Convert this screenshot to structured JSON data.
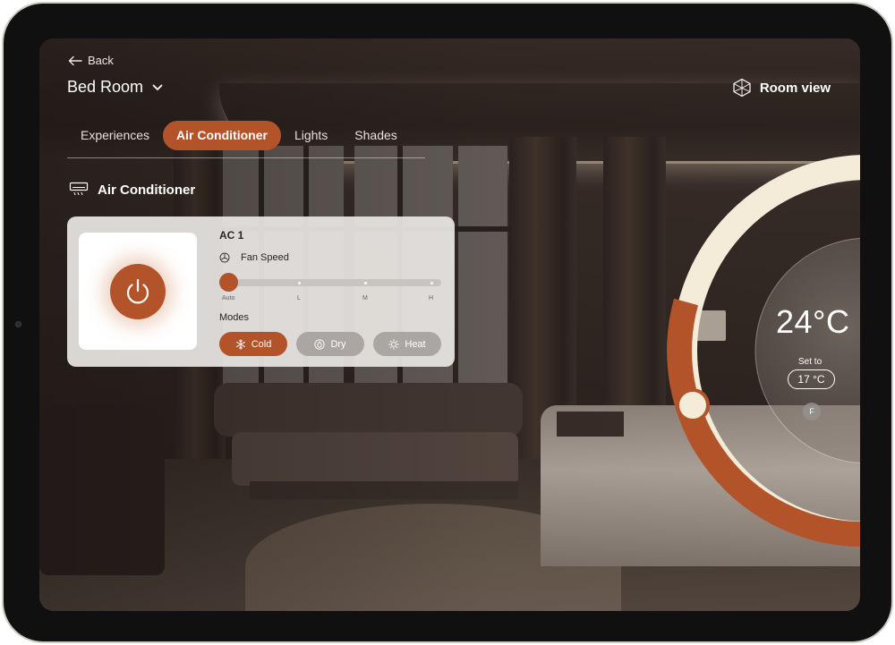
{
  "nav": {
    "back_label": "Back",
    "room_name": "Bed Room",
    "room_view_label": "Room view"
  },
  "tabs": [
    {
      "label": "Experiences",
      "active": false
    },
    {
      "label": "Air Conditioner",
      "active": true
    },
    {
      "label": "Lights",
      "active": false
    },
    {
      "label": "Shades",
      "active": false
    }
  ],
  "section": {
    "title": "Air Conditioner",
    "icon": "air-conditioner-icon"
  },
  "ac_card": {
    "name": "AC 1",
    "power_icon": "power-icon",
    "fan_speed_label": "Fan Speed",
    "fan_speed_ticks": [
      "Auto",
      "L",
      "M",
      "H"
    ],
    "fan_speed_value": "Auto",
    "modes_label": "Modes",
    "modes": [
      {
        "label": "Cold",
        "icon": "snowflake-icon",
        "active": true
      },
      {
        "label": "Dry",
        "icon": "droplet-icon",
        "active": false
      },
      {
        "label": "Heat",
        "icon": "sun-icon",
        "active": false
      }
    ]
  },
  "thermostat": {
    "current_temp": "24°C",
    "set_to_label": "Set to",
    "set_temp": "17 °C",
    "unit_toggle": "F",
    "dial_level": 0.53
  },
  "colors": {
    "accent": "#b3532a",
    "dial_track": "#f4ecd9",
    "card_bg": "#e8e5e2"
  }
}
